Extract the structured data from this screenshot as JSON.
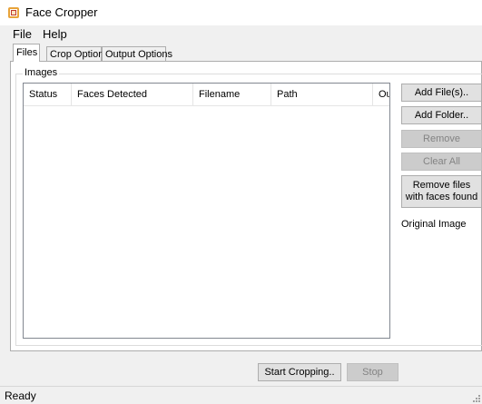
{
  "window": {
    "title": "Face Cropper",
    "icon": "app-icon"
  },
  "menu": {
    "file": "File",
    "help": "Help"
  },
  "tabs": [
    {
      "label": "Files",
      "active": true
    },
    {
      "label": "Crop Options",
      "active": false
    },
    {
      "label": "Output Options",
      "active": false
    }
  ],
  "images_group": {
    "label": "Images",
    "columns": [
      "Status",
      "Faces Detected",
      "Filename",
      "Path",
      "Ou"
    ],
    "rows": []
  },
  "buttons": {
    "add_files": "Add File(s)..",
    "add_folder": "Add Folder..",
    "remove": "Remove",
    "clear_all": "Clear All",
    "remove_with_faces": "Remove files with faces found"
  },
  "preview": {
    "label": "Original Image"
  },
  "actions": {
    "start": "Start Cropping..",
    "stop": "Stop"
  },
  "status": {
    "text": "Ready"
  },
  "colors": {
    "window_bg": "#f0f0f0",
    "panel_bg": "#ffffff",
    "icon_accent": "#e8a33a",
    "icon_dark": "#c0392b"
  }
}
